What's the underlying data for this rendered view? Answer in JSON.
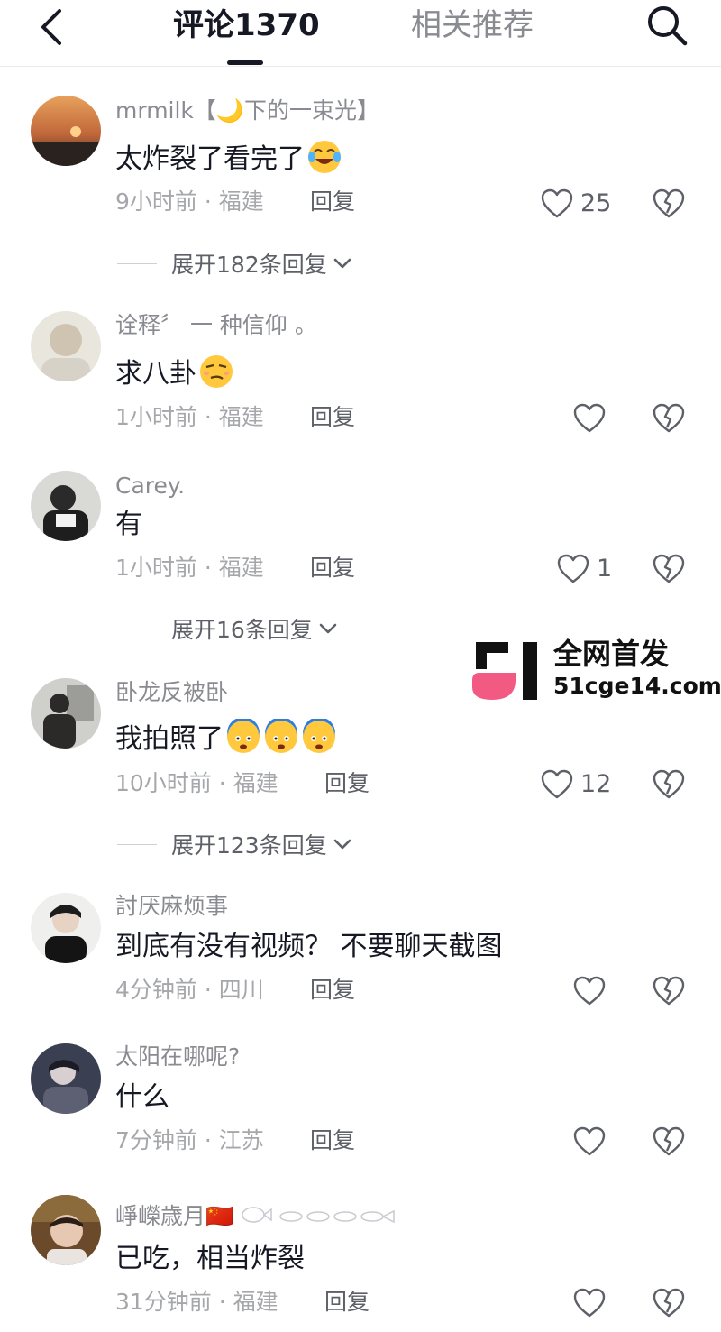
{
  "header": {
    "back_icon": "chevron-left-icon",
    "tabs": [
      {
        "label": "评论1370",
        "active": true
      },
      {
        "label": "相关推荐",
        "active": false
      }
    ],
    "search_icon": "search-icon"
  },
  "reply_label": "回复",
  "comments": [
    {
      "user": "mrmilk【🌙下的一束光】",
      "text": "太炸裂了看完了",
      "emojis": [
        "laughing-crying-emoji"
      ],
      "time": "9小时前 · 福建",
      "likes": "25",
      "expand": "展开182条回复"
    },
    {
      "user": "诠释〞 一 种信仰 。",
      "text": "求八卦",
      "emojis": [
        "smirk-emoji"
      ],
      "time": "1小时前 · 福建",
      "likes": "",
      "expand": ""
    },
    {
      "user": "Carey.",
      "text": "有",
      "emojis": [],
      "time": "1小时前 · 福建",
      "likes": "1",
      "expand": "展开16条回复"
    },
    {
      "user": "卧龙反被卧",
      "text": "我拍照了",
      "emojis": [
        "cold-sweat-emoji",
        "cold-sweat-emoji",
        "cold-sweat-emoji"
      ],
      "time": "10小时前 · 福建",
      "likes": "12",
      "expand": "展开123条回复"
    },
    {
      "user": "討厌麻烦事",
      "text": "到底有没有视频？ 不要聊天截图",
      "emojis": [],
      "time": "4分钟前 · 四川",
      "likes": "",
      "expand": ""
    },
    {
      "user": "太阳在哪呢?",
      "text": "什么",
      "emojis": [],
      "time": "7分钟前 · 江苏",
      "likes": "",
      "expand": ""
    },
    {
      "user": "崢嶸歳月🇨🇳",
      "text": "已吃，相当炸裂",
      "emojis": [],
      "time": "31分钟前 · 福建",
      "likes": "",
      "expand": ""
    }
  ],
  "watermark": {
    "title": "全网首发",
    "url": "51cge14.com"
  },
  "colors": {
    "text_primary": "#161823",
    "text_secondary": "#8a8b91",
    "divider": "#ececec",
    "watermark_pink": "#f25a84"
  }
}
